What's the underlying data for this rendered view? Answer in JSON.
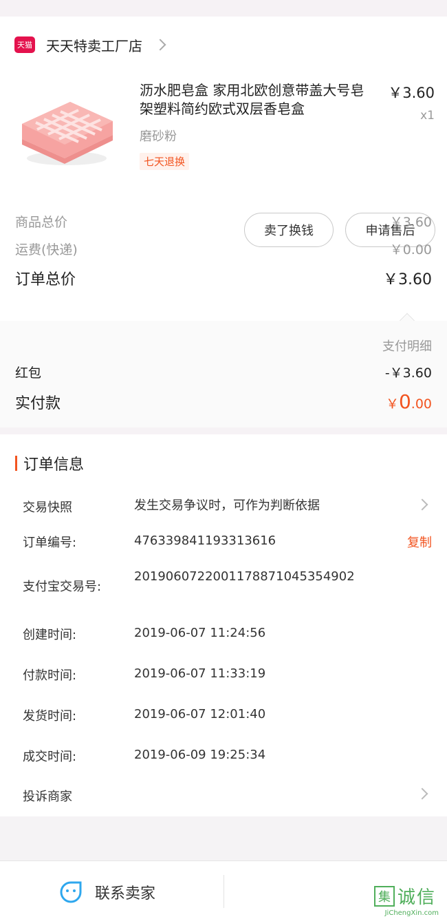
{
  "shop": {
    "badge": "天猫",
    "name": "天天特卖工厂店"
  },
  "product": {
    "title": "沥水肥皂盒 家用北欧创意带盖大号皂架塑料简约欧式双层香皂盒",
    "price": "￥3.60",
    "qty": "x1",
    "variant": "磨砂粉",
    "tag": "七天退换",
    "buttons": {
      "sell": "卖了换钱",
      "after_sale": "申请售后"
    }
  },
  "summary": {
    "goods_total_label": "商品总价",
    "goods_total_value": "￥3.60",
    "shipping_label": "运费(快递)",
    "shipping_value": "￥0.00",
    "order_total_label": "订单总价",
    "order_total_value": "￥3.60"
  },
  "payment": {
    "detail_link": "支付明细",
    "redpacket_label": "红包",
    "redpacket_value": "-￥3.60",
    "actual_label": "实付款",
    "actual_currency": "￥",
    "actual_int": "0",
    "actual_dec": ".00"
  },
  "order_info": {
    "title": "订单信息",
    "snapshot_label": "交易快照",
    "snapshot_value": "发生交易争议时，可作为判断依据",
    "order_no_label": "订单编号:",
    "order_no_value": "476339841193313616",
    "copy_label": "复制",
    "alipay_label": "支付宝交易号:",
    "alipay_value": "2019060722001178871045354902",
    "created_label": "创建时间:",
    "created_value": "2019-06-07 11:24:56",
    "paid_label": "付款时间:",
    "paid_value": "2019-06-07 11:33:19",
    "shipped_label": "发货时间:",
    "shipped_value": "2019-06-07 12:01:40",
    "closed_label": "成交时间:",
    "closed_value": "2019-06-09 19:25:34",
    "complain_label": "投诉商家"
  },
  "bottom": {
    "contact_label": "联系卖家",
    "watermark_box": "集",
    "watermark_text": "诚信",
    "watermark_url": "JiChengXin.com"
  },
  "colors": {
    "accent": "#f25420",
    "tmall": "#e4124d",
    "contact_icon": "#2ea7ee",
    "watermark": "#4fae5a"
  }
}
